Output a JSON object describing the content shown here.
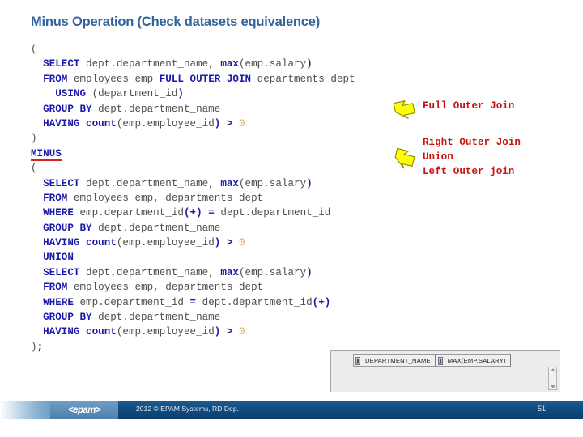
{
  "slide": {
    "title": "Minus Operation (Check datasets equivalence)",
    "title_color": "#31659c"
  },
  "code": {
    "lines": [
      [
        {
          "t": "(",
          "s": "plain"
        }
      ],
      [
        {
          "t": "  ",
          "s": "plain"
        },
        {
          "t": "SELECT",
          "s": "kw"
        },
        {
          "t": " dept.department_name, ",
          "s": "plain"
        },
        {
          "t": "max",
          "s": "kw"
        },
        {
          "t": "(emp.salary",
          "s": "plain"
        },
        {
          "t": ")",
          "s": "kw"
        }
      ],
      [
        {
          "t": "  ",
          "s": "plain"
        },
        {
          "t": "FROM",
          "s": "kw"
        },
        {
          "t": " employees emp ",
          "s": "plain"
        },
        {
          "t": "FULL OUTER JOIN",
          "s": "kw"
        },
        {
          "t": " departments dept",
          "s": "plain"
        }
      ],
      [
        {
          "t": "    ",
          "s": "plain"
        },
        {
          "t": "USING",
          "s": "kw"
        },
        {
          "t": " (department_id",
          "s": "plain"
        },
        {
          "t": ")",
          "s": "kw"
        }
      ],
      [
        {
          "t": "  ",
          "s": "plain"
        },
        {
          "t": "GROUP BY",
          "s": "kw"
        },
        {
          "t": " dept.department_name",
          "s": "plain"
        }
      ],
      [
        {
          "t": "  ",
          "s": "plain"
        },
        {
          "t": "HAVING count",
          "s": "kw"
        },
        {
          "t": "(emp.employee_id",
          "s": "plain"
        },
        {
          "t": ") > ",
          "s": "kw"
        },
        {
          "t": "0",
          "s": "num"
        }
      ],
      [
        {
          "t": ")",
          "s": "plain"
        }
      ],
      [
        {
          "t": "MINUS",
          "s": "kw-underline"
        }
      ],
      [
        {
          "t": "(",
          "s": "plain"
        }
      ],
      [
        {
          "t": "  ",
          "s": "plain"
        },
        {
          "t": "SELECT",
          "s": "kw"
        },
        {
          "t": " dept.department_name, ",
          "s": "plain"
        },
        {
          "t": "max",
          "s": "kw"
        },
        {
          "t": "(emp.salary",
          "s": "plain"
        },
        {
          "t": ")",
          "s": "kw"
        }
      ],
      [
        {
          "t": "  ",
          "s": "plain"
        },
        {
          "t": "FROM",
          "s": "kw"
        },
        {
          "t": " employees emp, departments dept",
          "s": "plain"
        }
      ],
      [
        {
          "t": "  ",
          "s": "plain"
        },
        {
          "t": "WHERE",
          "s": "kw"
        },
        {
          "t": " emp.department_id",
          "s": "plain"
        },
        {
          "t": "(+) =",
          "s": "kw"
        },
        {
          "t": " dept.department_id",
          "s": "plain"
        }
      ],
      [
        {
          "t": "  ",
          "s": "plain"
        },
        {
          "t": "GROUP BY",
          "s": "kw"
        },
        {
          "t": " dept.department_name",
          "s": "plain"
        }
      ],
      [
        {
          "t": "  ",
          "s": "plain"
        },
        {
          "t": "HAVING count",
          "s": "kw"
        },
        {
          "t": "(emp.employee_id",
          "s": "plain"
        },
        {
          "t": ") > ",
          "s": "kw"
        },
        {
          "t": "0",
          "s": "num"
        }
      ],
      [
        {
          "t": "  ",
          "s": "plain"
        },
        {
          "t": "UNION",
          "s": "kw"
        }
      ],
      [
        {
          "t": "  ",
          "s": "plain"
        },
        {
          "t": "SELECT",
          "s": "kw"
        },
        {
          "t": " dept.department_name, ",
          "s": "plain"
        },
        {
          "t": "max",
          "s": "kw"
        },
        {
          "t": "(emp.salary",
          "s": "plain"
        },
        {
          "t": ")",
          "s": "kw"
        }
      ],
      [
        {
          "t": "  ",
          "s": "plain"
        },
        {
          "t": "FROM",
          "s": "kw"
        },
        {
          "t": " employees emp, departments dept",
          "s": "plain"
        }
      ],
      [
        {
          "t": "  ",
          "s": "plain"
        },
        {
          "t": "WHERE",
          "s": "kw"
        },
        {
          "t": " emp.department_id ",
          "s": "plain"
        },
        {
          "t": "=",
          "s": "kw"
        },
        {
          "t": " dept.department_id",
          "s": "plain"
        },
        {
          "t": "(+)",
          "s": "kw"
        }
      ],
      [
        {
          "t": "  ",
          "s": "plain"
        },
        {
          "t": "GROUP BY",
          "s": "kw"
        },
        {
          "t": " dept.department_name",
          "s": "plain"
        }
      ],
      [
        {
          "t": "  ",
          "s": "plain"
        },
        {
          "t": "HAVING count",
          "s": "kw"
        },
        {
          "t": "(emp.employee_id",
          "s": "plain"
        },
        {
          "t": ") > ",
          "s": "kw"
        },
        {
          "t": "0",
          "s": "num"
        }
      ],
      [
        {
          "t": ")",
          "s": "plain"
        },
        {
          "t": ";",
          "s": "kw"
        }
      ]
    ],
    "keyword_color": "#1a1aa8",
    "text_color": "#5a5a5a",
    "number_color": "#d8a552",
    "underline_color": "#d32323"
  },
  "annotations": {
    "color": "#cc1111",
    "arrow_color": "#ffff00",
    "group1": {
      "arrow": "arrow-up-left-icon",
      "lines": [
        "Full Outer Join"
      ]
    },
    "group2": {
      "arrow": "arrow-down-left-icon",
      "lines": [
        "Right Outer Join",
        "Union",
        "Left Outer join"
      ]
    }
  },
  "result_grid": {
    "columns": [
      {
        "icon": "column-type-icon",
        "label": "DEPARTMENT_NAME"
      },
      {
        "icon": "column-type-icon",
        "label": "MAX(EMP.SALARY)"
      }
    ]
  },
  "footer": {
    "logo": "<epam>",
    "copyright": "2012 © EPAM Systems, RD Dep.",
    "page_number": "51"
  }
}
